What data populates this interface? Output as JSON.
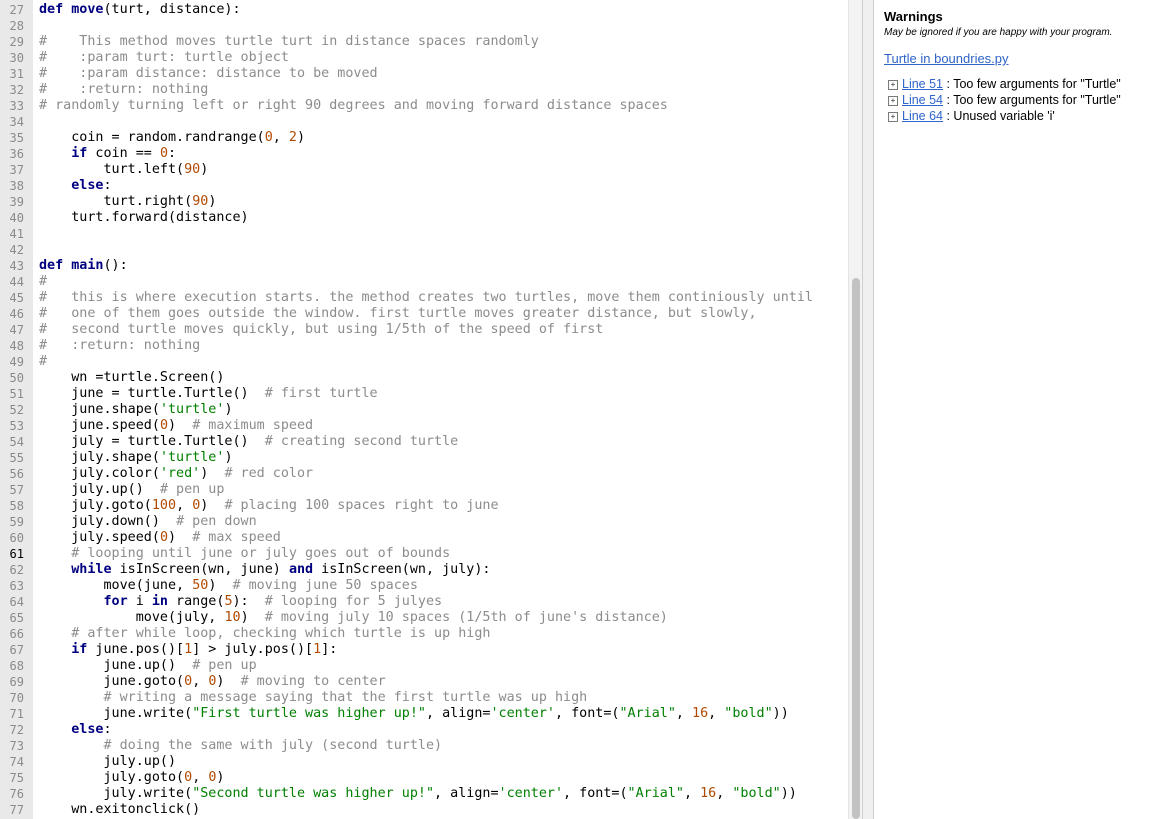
{
  "editor": {
    "current_line": "61",
    "lines": [
      {
        "n": "27",
        "t": [
          [
            "kw",
            "def "
          ],
          [
            "fn",
            "move"
          ],
          [
            "",
            "(turt, distance):"
          ]
        ]
      },
      {
        "n": "28",
        "t": []
      },
      {
        "n": "29",
        "t": [
          [
            "cmh",
            "#    This method moves turtle turt in distance spaces randomly"
          ]
        ]
      },
      {
        "n": "30",
        "t": [
          [
            "cmh",
            "#    :param turt: turtle object"
          ]
        ]
      },
      {
        "n": "31",
        "t": [
          [
            "cmh",
            "#    :param distance: distance to be moved"
          ]
        ]
      },
      {
        "n": "32",
        "t": [
          [
            "cmh",
            "#    :return: nothing"
          ]
        ]
      },
      {
        "n": "33",
        "t": [
          [
            "cmh",
            "# randomly turning left or right 90 degrees and moving forward distance spaces"
          ]
        ]
      },
      {
        "n": "34",
        "t": []
      },
      {
        "n": "35",
        "t": [
          [
            "",
            "    coin = random.randrange("
          ],
          [
            "num",
            "0"
          ],
          [
            "",
            ", "
          ],
          [
            "num",
            "2"
          ],
          [
            "",
            ")"
          ]
        ]
      },
      {
        "n": "36",
        "t": [
          [
            "",
            "    "
          ],
          [
            "kw",
            "if"
          ],
          [
            "",
            " coin == "
          ],
          [
            "num",
            "0"
          ],
          [
            "",
            ":"
          ]
        ]
      },
      {
        "n": "37",
        "t": [
          [
            "",
            "        turt.left("
          ],
          [
            "num",
            "90"
          ],
          [
            "",
            ")"
          ]
        ]
      },
      {
        "n": "38",
        "t": [
          [
            "",
            "    "
          ],
          [
            "kw",
            "else"
          ],
          [
            "",
            ":"
          ]
        ]
      },
      {
        "n": "39",
        "t": [
          [
            "",
            "        turt.right("
          ],
          [
            "num",
            "90"
          ],
          [
            "",
            ")"
          ]
        ]
      },
      {
        "n": "40",
        "t": [
          [
            "",
            "    turt.forward(distance)"
          ]
        ]
      },
      {
        "n": "41",
        "t": []
      },
      {
        "n": "42",
        "t": []
      },
      {
        "n": "43",
        "t": [
          [
            "kw",
            "def "
          ],
          [
            "fn",
            "main"
          ],
          [
            "",
            "():"
          ]
        ]
      },
      {
        "n": "44",
        "t": [
          [
            "cmh",
            "#"
          ]
        ]
      },
      {
        "n": "45",
        "t": [
          [
            "cmh",
            "#   this is where execution starts. the method creates two turtles, move them continiously until"
          ]
        ]
      },
      {
        "n": "46",
        "t": [
          [
            "cmh",
            "#   one of them goes outside the window. first turtle moves greater distance, but slowly,"
          ]
        ]
      },
      {
        "n": "47",
        "t": [
          [
            "cmh",
            "#   second turtle moves quickly, but using 1/5th of the speed of first"
          ]
        ]
      },
      {
        "n": "48",
        "t": [
          [
            "cmh",
            "#   :return: nothing"
          ]
        ]
      },
      {
        "n": "49",
        "t": [
          [
            "cmh",
            "#"
          ]
        ]
      },
      {
        "n": "50",
        "t": [
          [
            "",
            "    wn =turtle.Screen()"
          ]
        ]
      },
      {
        "n": "51",
        "t": [
          [
            "",
            "    june = turtle.Turtle()  "
          ],
          [
            "cm",
            "# first turtle"
          ]
        ]
      },
      {
        "n": "52",
        "t": [
          [
            "",
            "    june.shape("
          ],
          [
            "str",
            "'turtle'"
          ],
          [
            "",
            ")"
          ]
        ]
      },
      {
        "n": "53",
        "t": [
          [
            "",
            "    june.speed("
          ],
          [
            "num",
            "0"
          ],
          [
            "",
            ")  "
          ],
          [
            "cm",
            "# maximum speed"
          ]
        ]
      },
      {
        "n": "54",
        "t": [
          [
            "",
            "    july = turtle.Turtle()  "
          ],
          [
            "cm",
            "# creating second turtle"
          ]
        ]
      },
      {
        "n": "55",
        "t": [
          [
            "",
            "    july.shape("
          ],
          [
            "str",
            "'turtle'"
          ],
          [
            "",
            ")"
          ]
        ]
      },
      {
        "n": "56",
        "t": [
          [
            "",
            "    july.color("
          ],
          [
            "str",
            "'red'"
          ],
          [
            "",
            ")  "
          ],
          [
            "cm",
            "# red color"
          ]
        ]
      },
      {
        "n": "57",
        "t": [
          [
            "",
            "    july.up()  "
          ],
          [
            "cm",
            "# pen up"
          ]
        ]
      },
      {
        "n": "58",
        "t": [
          [
            "",
            "    july.goto("
          ],
          [
            "num",
            "100"
          ],
          [
            "",
            ", "
          ],
          [
            "num",
            "0"
          ],
          [
            "",
            ")  "
          ],
          [
            "cm",
            "# placing 100 spaces right to june"
          ]
        ]
      },
      {
        "n": "59",
        "t": [
          [
            "",
            "    july.down()  "
          ],
          [
            "cm",
            "# pen down"
          ]
        ]
      },
      {
        "n": "60",
        "t": [
          [
            "",
            "    july.speed("
          ],
          [
            "num",
            "0"
          ],
          [
            "",
            ")  "
          ],
          [
            "cm",
            "# max speed"
          ]
        ]
      },
      {
        "n": "61",
        "t": [
          [
            "",
            "    "
          ],
          [
            "cm",
            "# looping until june or july goes out of bounds"
          ]
        ]
      },
      {
        "n": "62",
        "t": [
          [
            "",
            "    "
          ],
          [
            "kw",
            "while"
          ],
          [
            "",
            " isInScreen(wn, june) "
          ],
          [
            "kw",
            "and"
          ],
          [
            "",
            " isInScreen(wn, july):"
          ]
        ]
      },
      {
        "n": "63",
        "t": [
          [
            "",
            "        move(june, "
          ],
          [
            "num",
            "50"
          ],
          [
            "",
            ")  "
          ],
          [
            "cm",
            "# moving june 50 spaces"
          ]
        ]
      },
      {
        "n": "64",
        "t": [
          [
            "",
            "        "
          ],
          [
            "kw",
            "for"
          ],
          [
            "",
            " i "
          ],
          [
            "kw",
            "in"
          ],
          [
            "",
            " range("
          ],
          [
            "num",
            "5"
          ],
          [
            "",
            "):  "
          ],
          [
            "cm",
            "# looping for 5 julyes"
          ]
        ]
      },
      {
        "n": "65",
        "t": [
          [
            "",
            "            move(july, "
          ],
          [
            "num",
            "10"
          ],
          [
            "",
            ")  "
          ],
          [
            "cm",
            "# moving july 10 spaces (1/5th of june's distance)"
          ]
        ]
      },
      {
        "n": "66",
        "t": [
          [
            "",
            "    "
          ],
          [
            "cm",
            "# after while loop, checking which turtle is up high"
          ]
        ]
      },
      {
        "n": "67",
        "t": [
          [
            "",
            "    "
          ],
          [
            "kw",
            "if"
          ],
          [
            "",
            " june.pos()["
          ],
          [
            "num",
            "1"
          ],
          [
            "",
            "] > july.pos()["
          ],
          [
            "num",
            "1"
          ],
          [
            "",
            "]:"
          ]
        ]
      },
      {
        "n": "68",
        "t": [
          [
            "",
            "        june.up()  "
          ],
          [
            "cm",
            "# pen up"
          ]
        ]
      },
      {
        "n": "69",
        "t": [
          [
            "",
            "        june.goto("
          ],
          [
            "num",
            "0"
          ],
          [
            "",
            ", "
          ],
          [
            "num",
            "0"
          ],
          [
            "",
            ")  "
          ],
          [
            "cm",
            "# moving to center"
          ]
        ]
      },
      {
        "n": "70",
        "t": [
          [
            "",
            "        "
          ],
          [
            "cm",
            "# writing a message saying that the first turtle was up high"
          ]
        ]
      },
      {
        "n": "71",
        "t": [
          [
            "",
            "        june.write("
          ],
          [
            "str",
            "\"First turtle was higher up!\""
          ],
          [
            "",
            ", align="
          ],
          [
            "str",
            "'center'"
          ],
          [
            "",
            ", font=("
          ],
          [
            "str",
            "\"Arial\""
          ],
          [
            "",
            ", "
          ],
          [
            "num",
            "16"
          ],
          [
            "",
            ", "
          ],
          [
            "str",
            "\"bold\""
          ],
          [
            "",
            "))"
          ]
        ]
      },
      {
        "n": "72",
        "t": [
          [
            "",
            "    "
          ],
          [
            "kw",
            "else"
          ],
          [
            "",
            ":"
          ]
        ]
      },
      {
        "n": "73",
        "t": [
          [
            "",
            "        "
          ],
          [
            "cm",
            "# doing the same with july (second turtle)"
          ]
        ]
      },
      {
        "n": "74",
        "t": [
          [
            "",
            "        july.up()"
          ]
        ]
      },
      {
        "n": "75",
        "t": [
          [
            "",
            "        july.goto("
          ],
          [
            "num",
            "0"
          ],
          [
            "",
            ", "
          ],
          [
            "num",
            "0"
          ],
          [
            "",
            ")"
          ]
        ]
      },
      {
        "n": "76",
        "t": [
          [
            "",
            "        july.write("
          ],
          [
            "str",
            "\"Second turtle was higher up!\""
          ],
          [
            "",
            ", align="
          ],
          [
            "str",
            "'center'"
          ],
          [
            "",
            ", font=("
          ],
          [
            "str",
            "\"Arial\""
          ],
          [
            "",
            ", "
          ],
          [
            "num",
            "16"
          ],
          [
            "",
            ", "
          ],
          [
            "str",
            "\"bold\""
          ],
          [
            "",
            "))"
          ]
        ]
      },
      {
        "n": "77",
        "t": [
          [
            "",
            "    wn.exitonclick()"
          ]
        ]
      }
    ]
  },
  "warnings": {
    "title": "Warnings",
    "subtitle": "May be ignored if you are happy with your program.",
    "file": "Turtle in boundries.py",
    "expand_glyph": "+",
    "items": [
      {
        "link": "Line 51",
        "msg": " : Too few arguments for \"Turtle\""
      },
      {
        "link": "Line 54",
        "msg": " : Too few arguments for \"Turtle\""
      },
      {
        "link": "Line 64",
        "msg": " : Unused variable 'i'"
      }
    ]
  }
}
